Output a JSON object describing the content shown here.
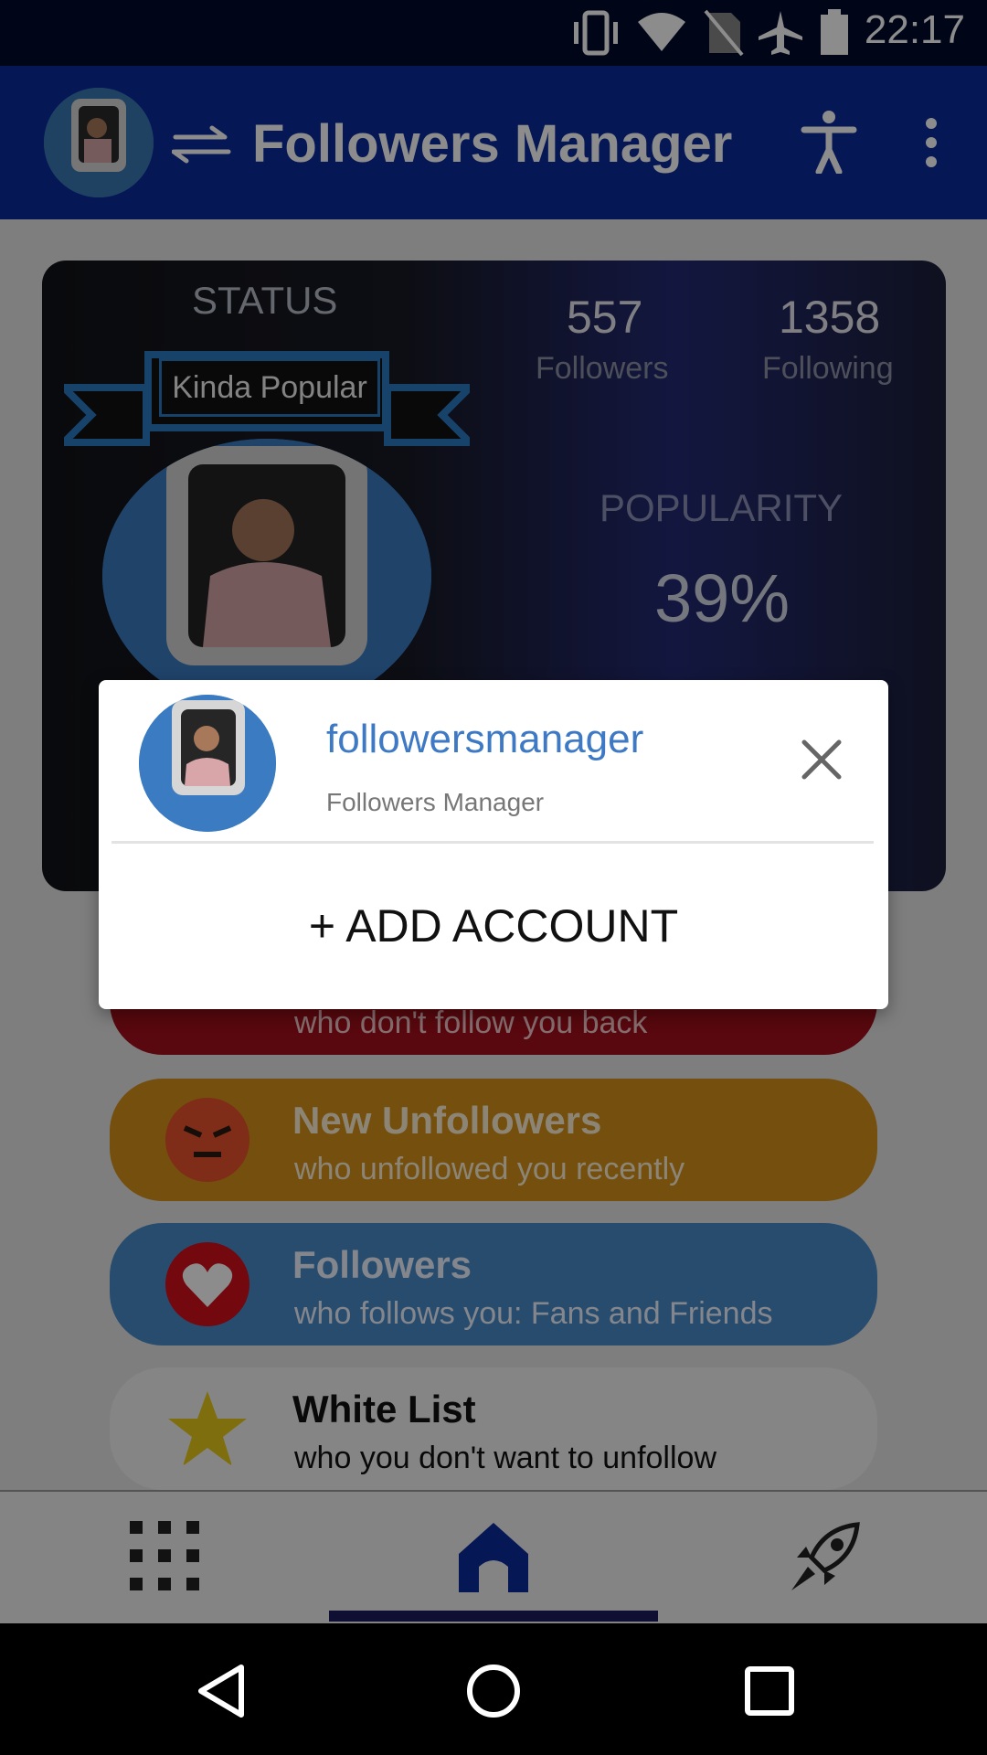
{
  "status_bar": {
    "time": "22:17"
  },
  "app_bar": {
    "title": "Followers Manager"
  },
  "status_card": {
    "status_label": "STATUS",
    "rank_badge": "Kinda Popular",
    "followers_count": "557",
    "followers_label": "Followers",
    "following_count": "1358",
    "following_label": "Following",
    "popularity_label": "POPULARITY",
    "popularity_value": "39%"
  },
  "list": {
    "non_followers_subtitle": "who don't follow you back",
    "new_unfollowers": {
      "title": "New Unfollowers",
      "subtitle": "who unfollowed you recently"
    },
    "followers": {
      "title": "Followers",
      "subtitle": "who follows you: Fans and Friends"
    },
    "white_list": {
      "title": "White List",
      "subtitle": "who you don't want to unfollow"
    }
  },
  "dialog": {
    "username": "followersmanager",
    "full_name": "Followers Manager",
    "add_account_label": "+ ADD ACCOUNT"
  },
  "colors": {
    "app_bar": "#0a2a9c",
    "red_item": "#a0101a",
    "orange_item": "#d49018",
    "blue_item": "#4a8ac8",
    "white_item": "#f2f2f2",
    "username_link": "#3d79c4"
  }
}
